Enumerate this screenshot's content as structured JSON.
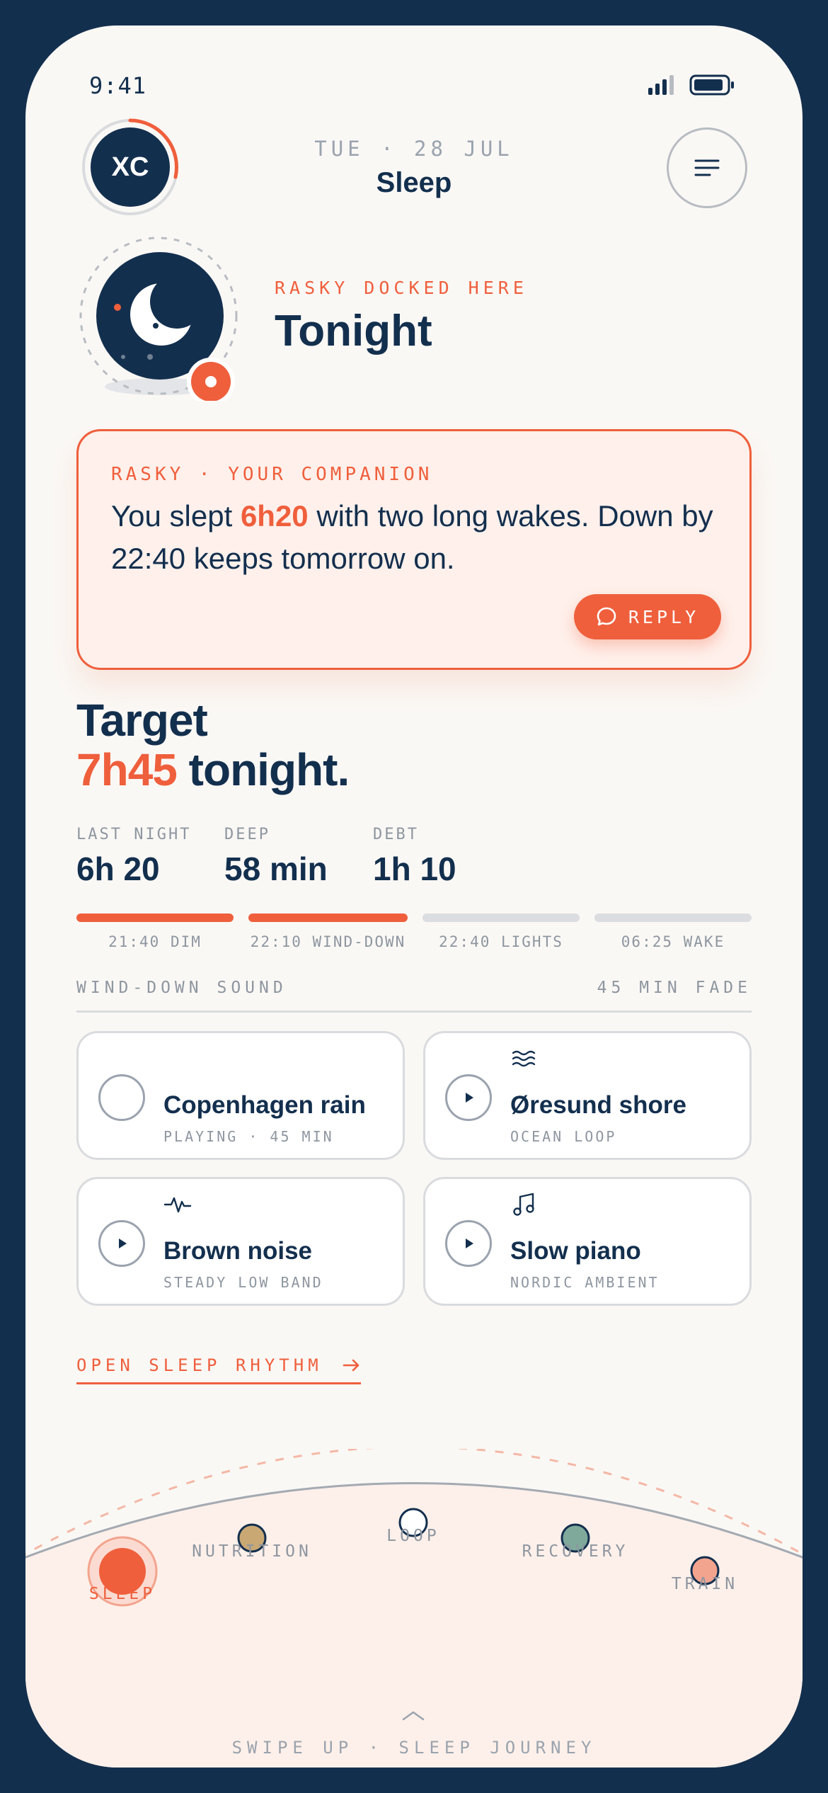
{
  "status": {
    "time": "9:41"
  },
  "header": {
    "date": "TUE · 28 JUL",
    "title": "Sleep",
    "avatar_initials": "XC"
  },
  "dock": {
    "label": "RASKY DOCKED HERE",
    "title": "Tonight"
  },
  "message": {
    "label": "RASKY · YOUR COMPANION",
    "text_before": "You slept ",
    "highlight": "6h20",
    "text_after": " with two long wakes. Down by 22:40 keeps tomorrow on.",
    "reply_label": "REPLY"
  },
  "target": {
    "line1": "Target",
    "value": "7h45",
    "suffix": " tonight."
  },
  "stats": [
    {
      "label": "LAST NIGHT",
      "value": "6h 20"
    },
    {
      "label": "DEEP",
      "value": "58 min"
    },
    {
      "label": "DEBT",
      "value": "1h 10"
    }
  ],
  "schedule": [
    {
      "label": "21:40 DIM",
      "done": true
    },
    {
      "label": "22:10 WIND-DOWN",
      "done": true
    },
    {
      "label": "22:40 LIGHTS",
      "done": false
    },
    {
      "label": "06:25 WAKE",
      "done": false
    }
  ],
  "wind_down": {
    "label": "WIND-DOWN SOUND",
    "fade": "45 MIN FADE"
  },
  "sounds": [
    {
      "title": "Copenhagen rain",
      "subtitle": "PLAYING · 45 MIN",
      "icon": "cloud-rain-icon",
      "playing": true
    },
    {
      "title": "Øresund shore",
      "subtitle": "OCEAN LOOP",
      "icon": "waves-icon",
      "playing": false
    },
    {
      "title": "Brown noise",
      "subtitle": "STEADY LOW BAND",
      "icon": "pulse-icon",
      "playing": false
    },
    {
      "title": "Slow piano",
      "subtitle": "NORDIC AMBIENT",
      "icon": "music-note-icon",
      "playing": false
    }
  ],
  "rhythm_link": "OPEN SLEEP RHYTHM",
  "journey": {
    "nodes": [
      {
        "label": "SLEEP",
        "color": "#ef5f3c",
        "active": true
      },
      {
        "label": "NUTRITION",
        "color": "#c9a874",
        "active": false
      },
      {
        "label": "LOOP",
        "color": "#ffffff",
        "active": false
      },
      {
        "label": "RECOVERY",
        "color": "#7fa99b",
        "active": false
      },
      {
        "label": "TRAIN",
        "color": "#f3a48e",
        "active": false
      }
    ],
    "swipe_hint": "SWIPE UP · SLEEP JOURNEY"
  },
  "colors": {
    "navy": "#132f4e",
    "accent": "#ef5f3c",
    "background": "#faf8f5"
  }
}
